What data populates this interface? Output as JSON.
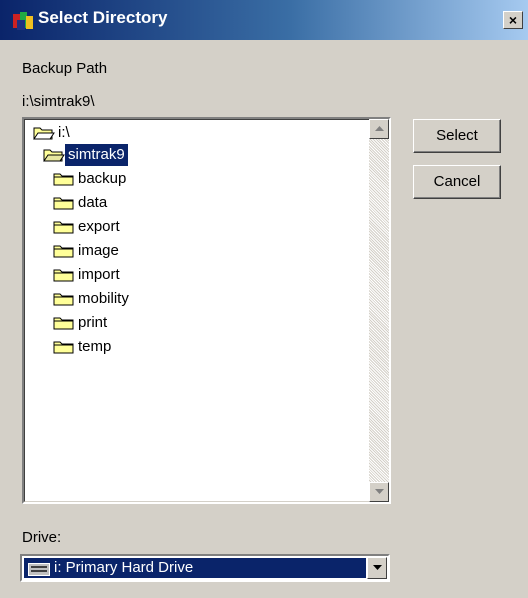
{
  "window": {
    "title": "Select Directory",
    "close_label": "×"
  },
  "labels": {
    "backup_path_caption": "Backup Path",
    "current_path": "i:\\simtrak9\\",
    "drive_caption": "Drive:"
  },
  "tree": {
    "root": "i:\\",
    "selected": "simtrak9",
    "children": [
      "backup",
      "data",
      "export",
      "image",
      "import",
      "mobility",
      "print",
      "temp"
    ]
  },
  "buttons": {
    "select": "Select",
    "cancel": "Cancel"
  },
  "drive_combo": {
    "value": "i: Primary Hard Drive"
  },
  "colors": {
    "selection": "#0a246a",
    "dialog_bg": "#d4d0c8",
    "folder_fill": "#ffff99"
  }
}
